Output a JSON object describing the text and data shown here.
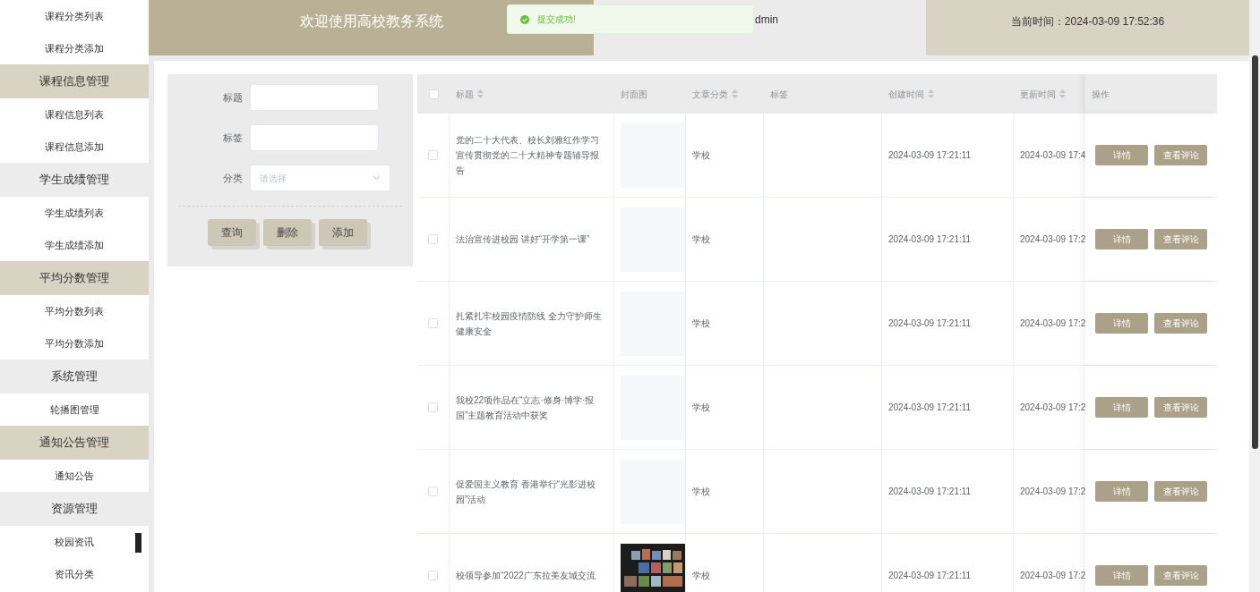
{
  "sidebar": {
    "items": [
      {
        "kind": "link",
        "label": "课程分类列表"
      },
      {
        "kind": "link",
        "label": "课程分类添加"
      },
      {
        "kind": "group",
        "label": "课程信息管理",
        "highlighted": true
      },
      {
        "kind": "link",
        "label": "课程信息列表"
      },
      {
        "kind": "link",
        "label": "课程信息添加"
      },
      {
        "kind": "group",
        "label": "学生成绩管理",
        "highlighted": false
      },
      {
        "kind": "link",
        "label": "学生成绩列表"
      },
      {
        "kind": "link",
        "label": "学生成绩添加"
      },
      {
        "kind": "group",
        "label": "平均分数管理",
        "highlighted": true
      },
      {
        "kind": "link",
        "label": "平均分数列表"
      },
      {
        "kind": "link",
        "label": "平均分数添加"
      },
      {
        "kind": "group",
        "label": "系统管理",
        "highlighted": false
      },
      {
        "kind": "link",
        "label": "轮播图管理"
      },
      {
        "kind": "group",
        "label": "通知公告管理",
        "highlighted": true
      },
      {
        "kind": "link",
        "label": "通知公告"
      },
      {
        "kind": "group",
        "label": "资源管理",
        "highlighted": false
      },
      {
        "kind": "link",
        "label": "校园资讯"
      },
      {
        "kind": "link",
        "label": "资讯分类"
      }
    ]
  },
  "header": {
    "title": "欢迎使用高校教务系统",
    "user": "dmin",
    "time": "当前时间：2024-03-09 17:52:36"
  },
  "toast": {
    "message": "提交成功!"
  },
  "search": {
    "fields": [
      {
        "kind": "text",
        "label": "标题"
      },
      {
        "kind": "text",
        "label": "标签"
      },
      {
        "kind": "select",
        "label": "分类",
        "placeholder": "请选择"
      }
    ],
    "buttons": [
      "查询",
      "删除",
      "添加"
    ]
  },
  "table": {
    "select_all_checked": false,
    "columns": [
      {
        "label": "标题",
        "sortable": true
      },
      {
        "label": "封面图",
        "sortable": false
      },
      {
        "label": "文章分类",
        "sortable": true
      },
      {
        "label": "标签",
        "sortable": false
      },
      {
        "label": "创建时间",
        "sortable": true
      },
      {
        "label": "更新时间",
        "sortable": true
      },
      {
        "label": "操作",
        "sortable": false
      }
    ],
    "rows": [
      {
        "checked": false,
        "title": "党的二十大代表、校长刘雅红作学习宣传贯彻党的二十大精神专题辅导报告",
        "cover": {
          "kind": "placeholder"
        },
        "category": "学校",
        "created": "2024-03-09 17:21:11",
        "updated": "2024-03-09 17:4",
        "actions": [
          "详情",
          "查看评论"
        ]
      },
      {
        "checked": false,
        "title": "法治宣传进校园 讲好“开学第一课”",
        "cover": {
          "kind": "placeholder"
        },
        "category": "学校",
        "created": "2024-03-09 17:21:11",
        "updated": "2024-03-09 17:2",
        "actions": [
          "详情",
          "查看评论"
        ]
      },
      {
        "checked": false,
        "title": "扎紧扎牢校园疫情防线 全力守护师生健康安全",
        "cover": {
          "kind": "placeholder"
        },
        "category": "学校",
        "created": "2024-03-09 17:21:11",
        "updated": "2024-03-09 17:2",
        "actions": [
          "详情",
          "查看评论"
        ]
      },
      {
        "checked": false,
        "title": "我校22项作品在“立志·修身·博学·报国”主题教育活动中获奖",
        "cover": {
          "kind": "placeholder"
        },
        "category": "学校",
        "created": "2024-03-09 17:21:11",
        "updated": "2024-03-09 17:2",
        "actions": [
          "详情",
          "查看评论"
        ]
      },
      {
        "checked": false,
        "title": "促爱国主义教育 香港举行“光影进校园”活动",
        "cover": {
          "kind": "placeholder"
        },
        "category": "学校",
        "created": "2024-03-09 17:21:11",
        "updated": "2024-03-09 17:2",
        "actions": [
          "详情",
          "查看评论"
        ]
      },
      {
        "checked": false,
        "title": "校领导参加“2022广东拉美友城交流",
        "cover": {
          "kind": "picture"
        },
        "category": "学校",
        "created": "2024-03-09 17:21:11",
        "updated": "2024-03-09 17:2",
        "actions": [
          "详情",
          "查看评论"
        ]
      }
    ]
  }
}
